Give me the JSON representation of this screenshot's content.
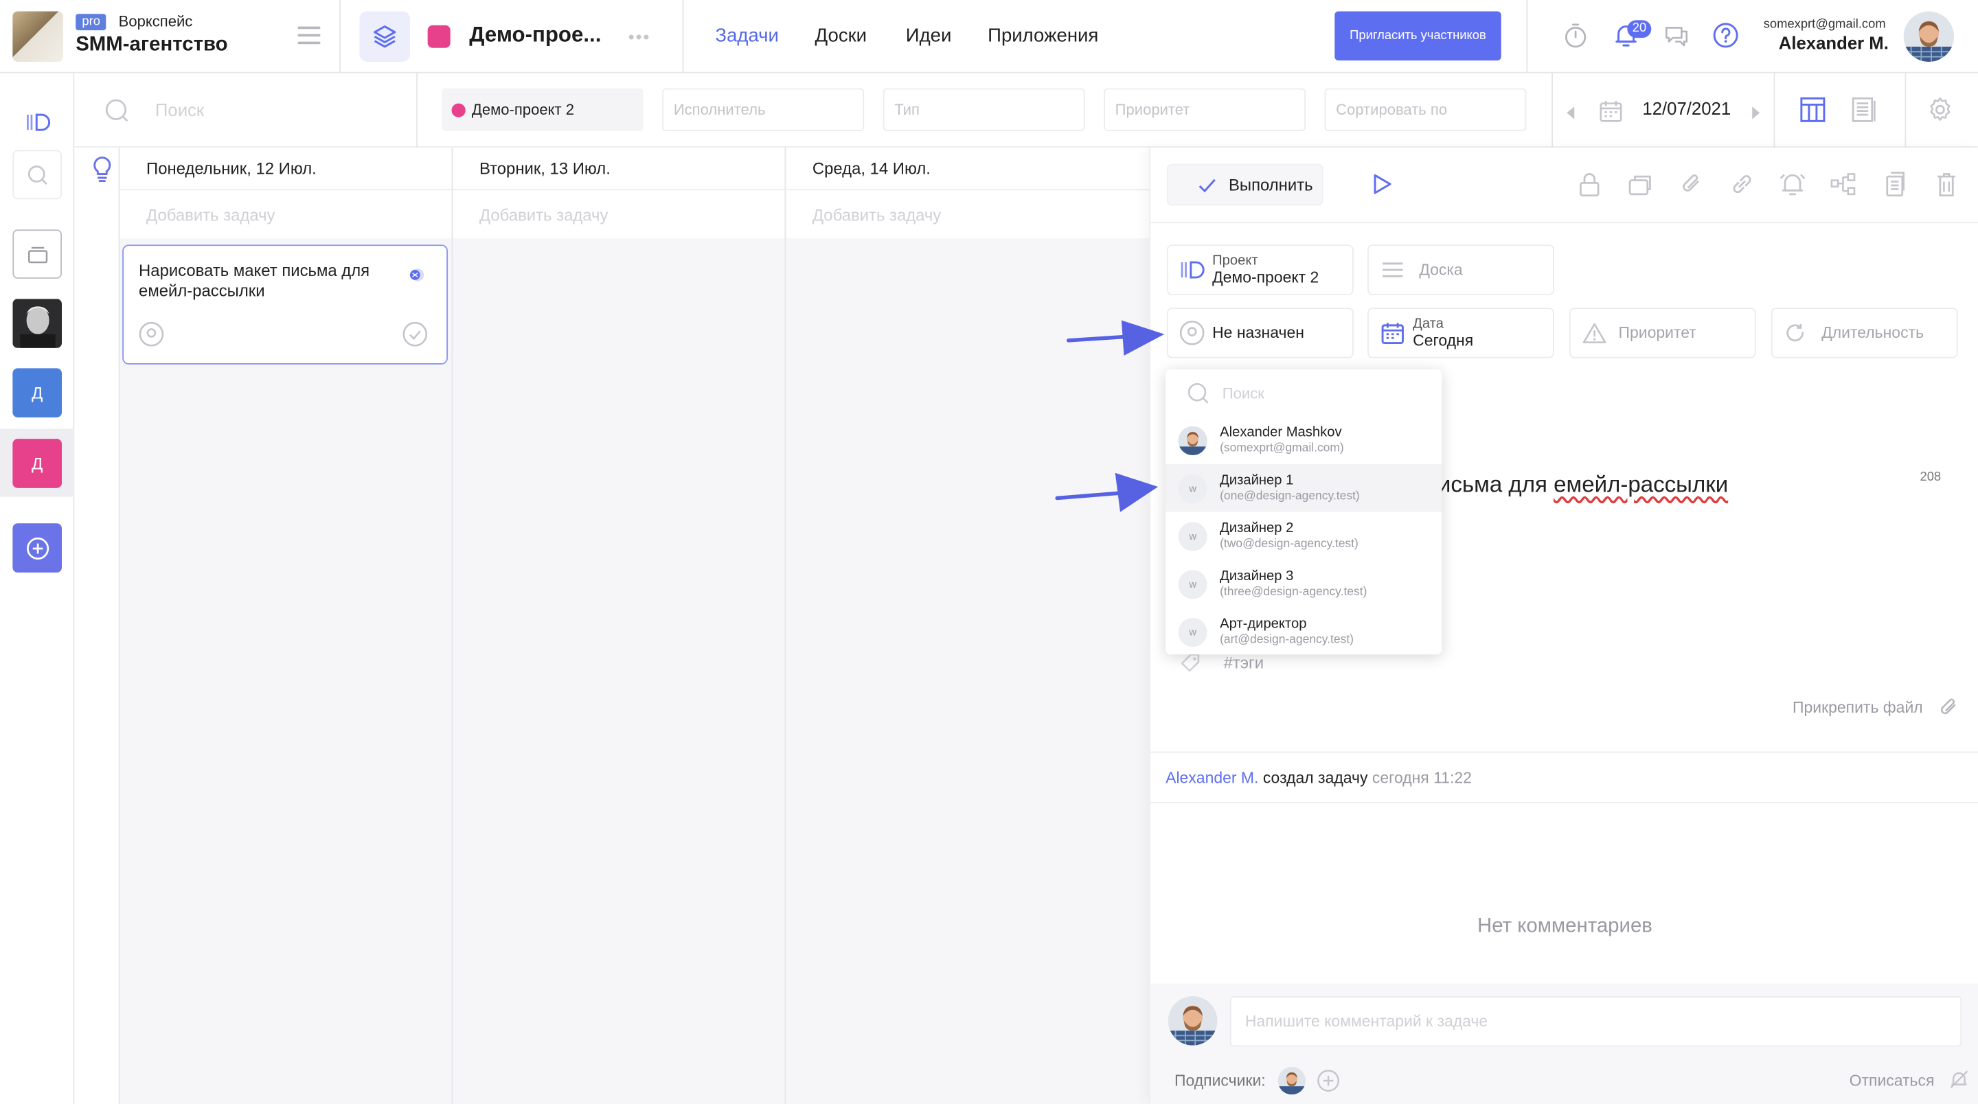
{
  "header": {
    "workspace_badge": "pro",
    "workspace_label": "Воркспейс",
    "workspace_name": "SMM-агентство",
    "project_title": "Демо-прое...",
    "tabs": [
      {
        "label": "Задачи",
        "active": true
      },
      {
        "label": "Доски",
        "active": false
      },
      {
        "label": "Идеи",
        "active": false
      },
      {
        "label": "Приложения",
        "active": false
      }
    ],
    "invite_button": "Пригласить участников",
    "notifications_count": "20",
    "user_email": "somexprt@gmail.com",
    "user_name": "Alexander M.",
    "accent_color": "#5e6ef0",
    "project_color": "#e8418b"
  },
  "rail": {
    "items": [
      {
        "icon": "project-board-icon"
      },
      {
        "icon": "search-icon"
      },
      {
        "icon": "inbox-icon"
      },
      {
        "icon": "user-photo-avatar"
      },
      {
        "letter": "Д",
        "color": "#4a7fdc"
      },
      {
        "letter": "Д",
        "color": "#e8418b",
        "active": true
      },
      {
        "icon": "add-circle-icon",
        "color": "#6a73e8"
      }
    ]
  },
  "filters": {
    "search_placeholder": "Поиск",
    "project_chip": "Демо-проект 2",
    "assignee_placeholder": "Исполнитель",
    "type_placeholder": "Тип",
    "priority_placeholder": "Приоритет",
    "sort_placeholder": "Сортировать по",
    "date": "12/07/2021"
  },
  "board": {
    "days": [
      {
        "title": "Понедельник, 12 Июл.",
        "add": "Добавить задачу"
      },
      {
        "title": "Вторник, 13 Июл.",
        "add": "Добавить задачу"
      },
      {
        "title": "Среда, 14 Июл.",
        "add": "Добавить задачу"
      }
    ],
    "task": {
      "title": "Нарисовать макет письма для емейл-рассылки"
    }
  },
  "panel": {
    "complete_button": "Выполнить",
    "project": {
      "label": "Проект",
      "value": "Демо-проект 2"
    },
    "board_placeholder": "Доска",
    "assignee_value": "Не назначен",
    "date": {
      "label": "Дата",
      "value": "Сегодня"
    },
    "priority_placeholder": "Приоритет",
    "duration_placeholder": "Длительность",
    "title_visible_part": "исьма для ",
    "title_underlined_part": "емейл-рассылки",
    "task_number": "208",
    "tags_placeholder": "#тэги",
    "attach_file": "Прикрепить файл",
    "activity": {
      "author": "Alexander M.",
      "action": "создал задачу",
      "time": "сегодня 11:22"
    },
    "no_comments": "Нет комментариев",
    "comment_placeholder": "Напишите комментарий к задаче",
    "subscribers_label": "Подписчики:",
    "unsubscribe": "Отписаться"
  },
  "assignee_dropdown": {
    "search_placeholder": "Поиск",
    "users": [
      {
        "name": "Alexander Mashkov",
        "email": "(somexprt@gmail.com)",
        "avatar": "photo"
      },
      {
        "name": "Дизайнер 1",
        "email": "(one@design-agency.test)",
        "avatar": "w",
        "highlighted": true
      },
      {
        "name": "Дизайнер 2",
        "email": "(two@design-agency.test)",
        "avatar": "w"
      },
      {
        "name": "Дизайнер 3",
        "email": "(three@design-agency.test)",
        "avatar": "w"
      },
      {
        "name": "Арт-директор",
        "email": "(art@design-agency.test)",
        "avatar": "w"
      }
    ]
  }
}
